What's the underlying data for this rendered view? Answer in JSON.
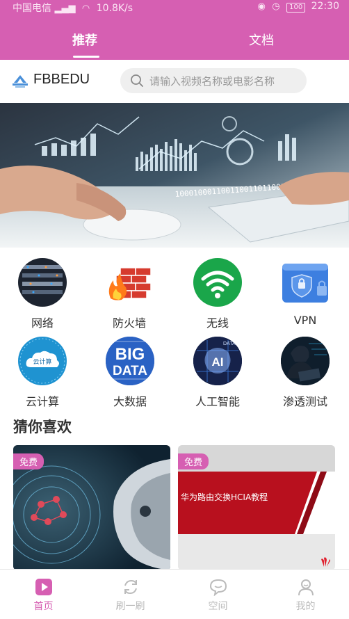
{
  "status_bar": {
    "carrier": "中国电信",
    "network_speed": "10.8K/s",
    "battery": "100",
    "time": "22:30"
  },
  "top_tabs": [
    {
      "label": "推荐",
      "active": true
    },
    {
      "label": "文档",
      "active": false
    }
  ],
  "brand": {
    "name": "FBBEDU"
  },
  "search": {
    "placeholder": "请输入视频名称或电影名称"
  },
  "banner": {
    "binary_text": "1000100011001100110110010"
  },
  "categories": [
    {
      "label": "网络",
      "icon": "network-icon"
    },
    {
      "label": "防火墙",
      "icon": "firewall-icon"
    },
    {
      "label": "无线",
      "icon": "wifi-icon"
    },
    {
      "label": "VPN",
      "icon": "vpn-icon"
    },
    {
      "label": "云计算",
      "icon": "cloud-computing-icon"
    },
    {
      "label": "大数据",
      "icon": "big-data-icon"
    },
    {
      "label": "人工智能",
      "icon": "ai-icon"
    },
    {
      "label": "渗透测试",
      "icon": "penetration-test-icon"
    }
  ],
  "category_art": {
    "cloud_text": "云计算",
    "bigdata_line1": "BIG",
    "bigdata_line2": "DATA",
    "ai_text": "AI",
    "ai_data_text": "DATA"
  },
  "recommend": {
    "title": "猜你喜欢",
    "cards": [
      {
        "badge": "免费",
        "caption": ""
      },
      {
        "badge": "免费",
        "caption": "华为路由交换HCIA教程"
      }
    ]
  },
  "bottom_nav": [
    {
      "label": "首页",
      "icon": "home-play-icon",
      "active": true
    },
    {
      "label": "刷一刷",
      "icon": "refresh-icon",
      "active": false
    },
    {
      "label": "空间",
      "icon": "chat-bubble-icon",
      "active": false
    },
    {
      "label": "我的",
      "icon": "profile-icon",
      "active": false
    }
  ],
  "colors": {
    "accent": "#d65fb2",
    "wifi_green": "#1aa64a",
    "vpn_blue": "#3d7fe0"
  }
}
